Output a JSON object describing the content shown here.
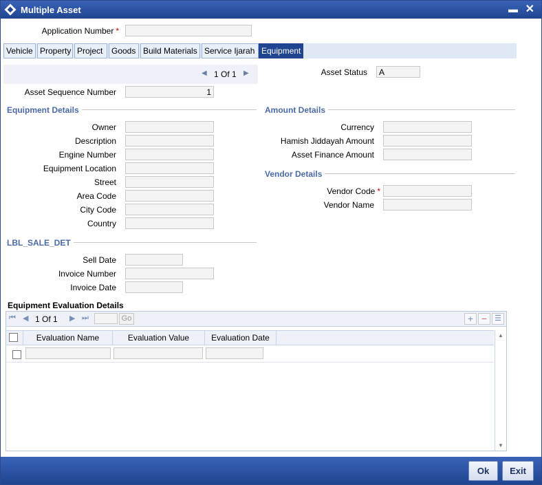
{
  "window": {
    "title": "Multiple Asset",
    "minimize": "▬",
    "close": "✕"
  },
  "header": {
    "app_number_label": "Application Number",
    "app_number_value": "",
    "required_mark": "*"
  },
  "tabs": [
    "Vehicle",
    "Property",
    "Project",
    "Goods",
    "Build Materials",
    "Service Ijarah",
    "Equipment"
  ],
  "active_tab": "Equipment",
  "pager": {
    "text": "1 Of 1"
  },
  "asset": {
    "status_label": "Asset Status",
    "status_value": "A",
    "seq_label": "Asset Sequence Number",
    "seq_value": "1"
  },
  "equipment": {
    "title": "Equipment Details",
    "owner": "Owner",
    "description": "Description",
    "engine_number": "Engine Number",
    "location": "Equipment Location",
    "street": "Street",
    "area_code": "Area Code",
    "city_code": "City Code",
    "country": "Country"
  },
  "amount": {
    "title": "Amount Details",
    "currency": "Currency",
    "hamish": "Hamish Jiddayah Amount",
    "finance": "Asset Finance Amount"
  },
  "vendor": {
    "title": "Vendor Details",
    "code": "Vendor Code",
    "name": "Vendor Name"
  },
  "sale": {
    "title": "LBL_SALE_DET",
    "sell_date": "Sell Date",
    "invoice_number": "Invoice Number",
    "invoice_date": "Invoice Date"
  },
  "grid": {
    "title": "Equipment Evaluation Details",
    "pager": "1 Of 1",
    "go": "Go",
    "columns": [
      "Evaluation Name",
      "Evaluation Value",
      "Evaluation Date"
    ]
  },
  "footer": {
    "ok": "Ok",
    "exit": "Exit"
  },
  "colors": {
    "titlebar": "#1f4590",
    "section": "#4b6aa8",
    "required": "#cc0000"
  }
}
